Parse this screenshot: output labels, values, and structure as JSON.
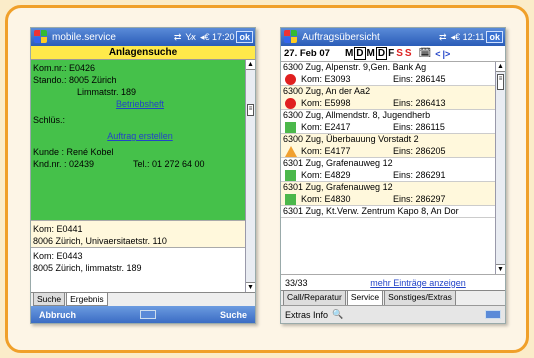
{
  "left": {
    "titlebar": {
      "title": "mobile.service",
      "time": "◂€ 17:20",
      "ok": "ok"
    },
    "header": "Anlagensuche",
    "details": {
      "komnr": "Kom.nr.: E0426",
      "standort": "Stando.: 8005 Zürich",
      "street": "Limmatstr. 189",
      "betriebsheft": "Betriebsheft",
      "schluss": "Schlüs.:",
      "auftrag": "Auftrag erstellen",
      "kunde": "Kunde  : René Kobel",
      "kndnr": "Knd.nr. : 02439",
      "tel": "Tel.: 01 272 64 00"
    },
    "results": [
      {
        "kom": "Kom:  E0441",
        "addr": "8006 Zürich, Univaersitaetstr. 110"
      },
      {
        "kom": "Kom:  E0443",
        "addr": "8005 Zürich, limmatstr. 189"
      }
    ],
    "tabs": [
      "Suche",
      "Ergebnis"
    ],
    "softkeys": {
      "left": "Abbruch",
      "right": "Suche"
    }
  },
  "right": {
    "titlebar": {
      "title": "Auftragsübersicht",
      "time": "◂€ 12:11",
      "ok": "ok"
    },
    "datebar": {
      "date": "27. Feb 07",
      "days": [
        "M",
        "D",
        "M",
        "D",
        "F",
        "S",
        "S"
      ]
    },
    "entries": [
      {
        "line1": "6300 Zug, Alpenstr. 9,Gen. Bank Ag",
        "kom": "Kom: E3093",
        "eins": "Eins:  286145",
        "marker": "red-dot",
        "bg": "#ffffff"
      },
      {
        "line1": "6300 Zug, An der Aa2",
        "kom": "Kom: E5998",
        "eins": "Eins:  286413",
        "marker": "red-dot",
        "bg": "#fff8dc"
      },
      {
        "line1": "6300 Zug, Allmendstr. 8, Jugendherb",
        "kom": "Kom: E2417",
        "eins": "Eins:  286115",
        "marker": "green-square",
        "bg": "#ffffff"
      },
      {
        "line1": "6300 Zug, Überbauung Vorstadt 2",
        "kom": "Kom: E4177",
        "eins": "Eins:  286205",
        "marker": "orange-triangle",
        "bg": "#fff8dc"
      },
      {
        "line1": "6301 Zug, Grafenauweg 12",
        "kom": "Kom: E4829",
        "eins": "Eins:  286291",
        "marker": "green-square",
        "bg": "#ffffff"
      },
      {
        "line1": "6301 Zug, Grafenauweg 12",
        "kom": "Kom: E4830",
        "eins": "Eins:  286297",
        "marker": "green-square",
        "bg": "#fff8dc"
      },
      {
        "line1": "6301 Zug, Kt.Verw. Zentrum Kapo 8, An Dor",
        "kom": "",
        "eins": "",
        "marker": "",
        "bg": "#ffffff"
      }
    ],
    "count": "33/33",
    "more_link": "mehr Einträge anzeigen",
    "tabs": [
      "Call/Reparatur",
      "Service",
      "Sonstiges/Extras"
    ],
    "menu": "Extras Info"
  }
}
